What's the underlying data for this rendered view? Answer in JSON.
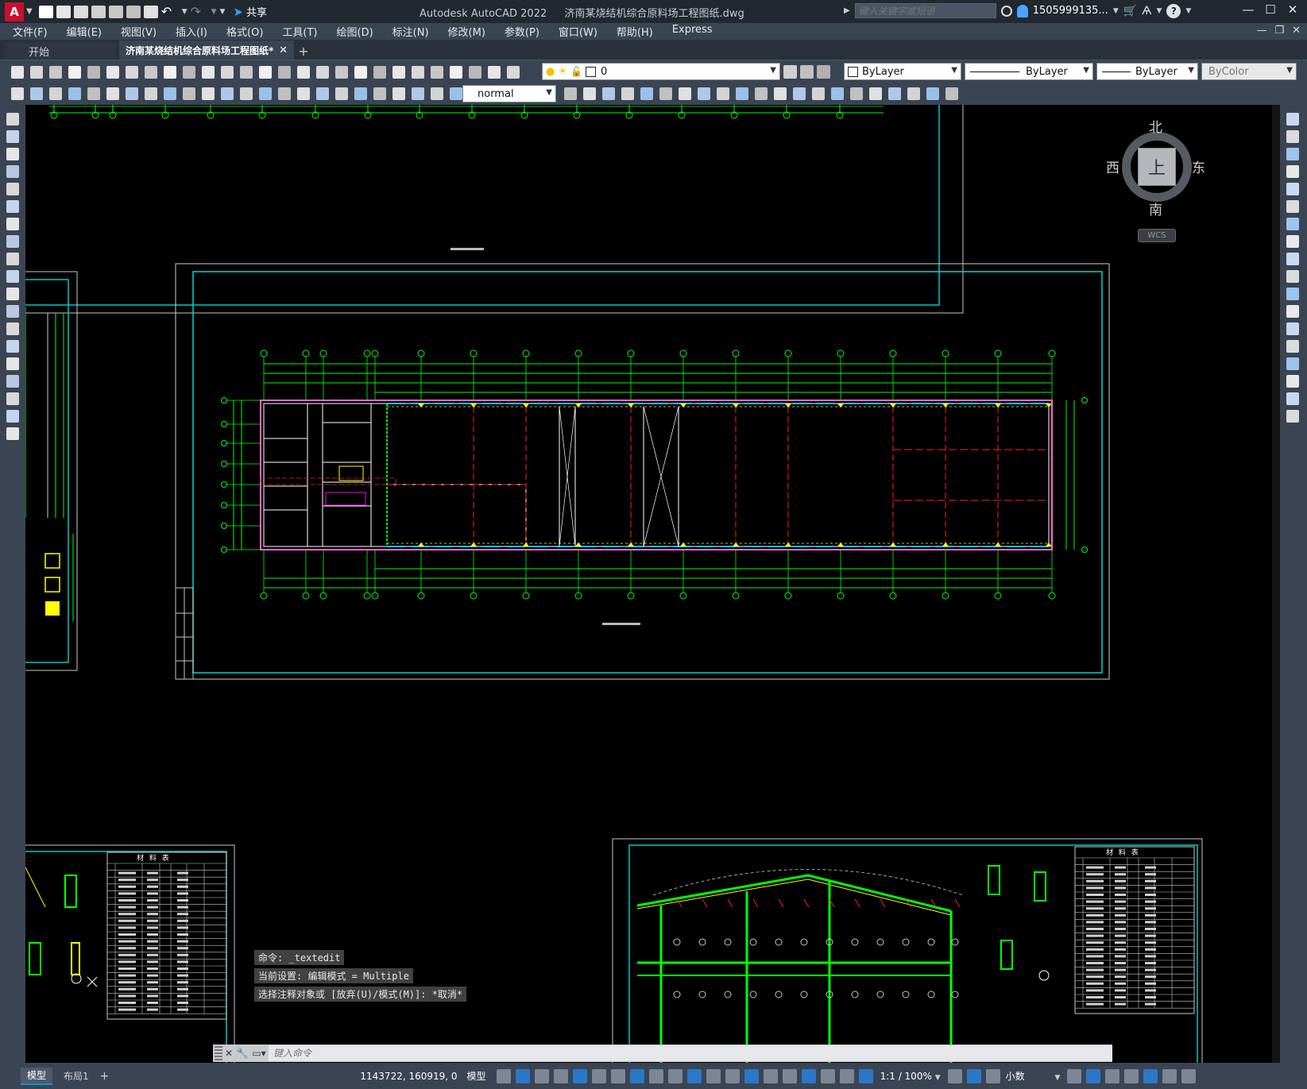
{
  "app": {
    "title": "Autodesk AutoCAD 2022",
    "document": "济南某烧结机综合原料场工程图纸.dwg",
    "share_label": "共享",
    "search_placeholder": "键入关键字或短语",
    "user": "1505999135...",
    "help": "?"
  },
  "menu": [
    "文件(F)",
    "编辑(E)",
    "视图(V)",
    "插入(I)",
    "格式(O)",
    "工具(T)",
    "绘图(D)",
    "标注(N)",
    "修改(M)",
    "参数(P)",
    "窗口(W)",
    "帮助(H)",
    "Express"
  ],
  "tabs": {
    "start": "开始",
    "drawing": "济南某烧结机综合原料场工程图纸*",
    "add": "+"
  },
  "props": {
    "layer": "0",
    "color": "ByLayer",
    "linetype": "ByLayer",
    "lineweight": "ByLayer",
    "plotstyle": "ByColor",
    "style": "normal"
  },
  "viewcube": {
    "north": "北",
    "south": "南",
    "east": "东",
    "west": "西",
    "top": "上",
    "wcs": "WCS"
  },
  "command": {
    "history": [
      "命令: _textedit",
      "当前设置: 编辑模式 = Multiple",
      "选择注释对象或 [放弃(U)/模式(M)]: *取消*"
    ],
    "placeholder": "键入命令"
  },
  "layout_tabs": {
    "model": "模型",
    "layout1": "布局1",
    "add": "+"
  },
  "status": {
    "coords": "1143722, 160919, 0",
    "space": "模型",
    "scale": "1:1 / 100%",
    "units": "小数"
  },
  "drawing": {
    "table_title": "材 料 表"
  },
  "colors": {
    "accent": "#0696d7",
    "grid_green": "#00ff00",
    "border_cyan": "#00c8c8",
    "axis_red": "#ff2020",
    "yellow": "#ffff00",
    "magenta": "#ff00ff"
  }
}
